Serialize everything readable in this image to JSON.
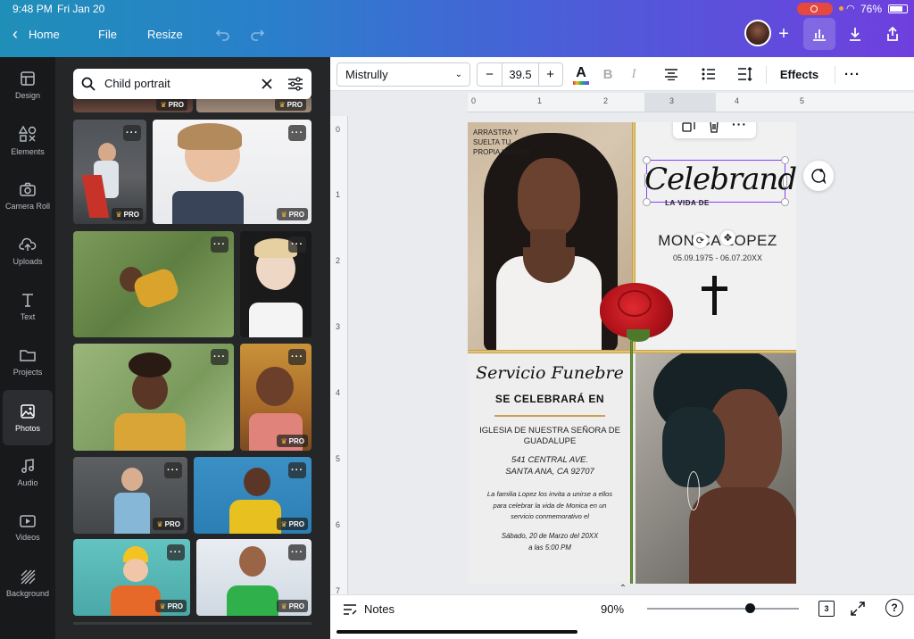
{
  "status_bar": {
    "time": "9:48 PM",
    "date": "Fri Jan 20",
    "battery": "76%"
  },
  "header": {
    "home_label": "Home",
    "file_label": "File",
    "resize_label": "Resize"
  },
  "rail": {
    "items": [
      {
        "label": "Design",
        "icon": "design-icon"
      },
      {
        "label": "Elements",
        "icon": "elements-icon"
      },
      {
        "label": "Camera Roll",
        "icon": "camera-icon"
      },
      {
        "label": "Uploads",
        "icon": "upload-icon"
      },
      {
        "label": "Text",
        "icon": "text-icon"
      },
      {
        "label": "Projects",
        "icon": "folder-icon"
      },
      {
        "label": "Photos",
        "icon": "photo-icon"
      },
      {
        "label": "Audio",
        "icon": "music-icon"
      },
      {
        "label": "Videos",
        "icon": "video-icon"
      },
      {
        "label": "Background",
        "icon": "background-icon"
      }
    ]
  },
  "search": {
    "query": "Child portrait"
  },
  "badges": {
    "pro": "PRO"
  },
  "toolbar": {
    "font": "Mistrully",
    "font_size": "39.5",
    "minus": "−",
    "plus": "+",
    "bold": "B",
    "italic": "I",
    "effects": "Effects",
    "text_color": "#e0393e"
  },
  "ruler": {
    "top": [
      "0",
      "1",
      "2",
      "3",
      "4",
      "5"
    ],
    "left": [
      "0",
      "1",
      "2",
      "3",
      "4",
      "5",
      "6",
      "7"
    ]
  },
  "design": {
    "upload_hint": [
      "ARRASTRA Y",
      "SUELTA TU",
      "PROPIA IMAGEN"
    ],
    "celebrando": "Celebrando",
    "la_vida_de": "LA VIDA DE",
    "name": "MONICA LOPEZ",
    "dates": "05.09.1975 - 06.07.20XX",
    "servicio": "Servicio Funebre",
    "se_celebrara": "SE CELEBRARÁ EN",
    "church": [
      "IGLESIA DE NUESTRA SEÑORA DE",
      "GUADALUPE"
    ],
    "address": [
      "541 CENTRAL AVE.",
      "SANTA ANA, CA 92707"
    ],
    "invite": [
      "La familia Lopez los invita a unirse a ellos",
      "para celebrar la vida de Monica en un",
      "servicio conmemorativo el"
    ],
    "when": [
      "Sábado, 20 de Marzo del 20XX",
      "a las 5:00 PM"
    ]
  },
  "bottom": {
    "notes": "Notes",
    "zoom": "90%",
    "pages": "3",
    "zoom_level": 0.68
  }
}
